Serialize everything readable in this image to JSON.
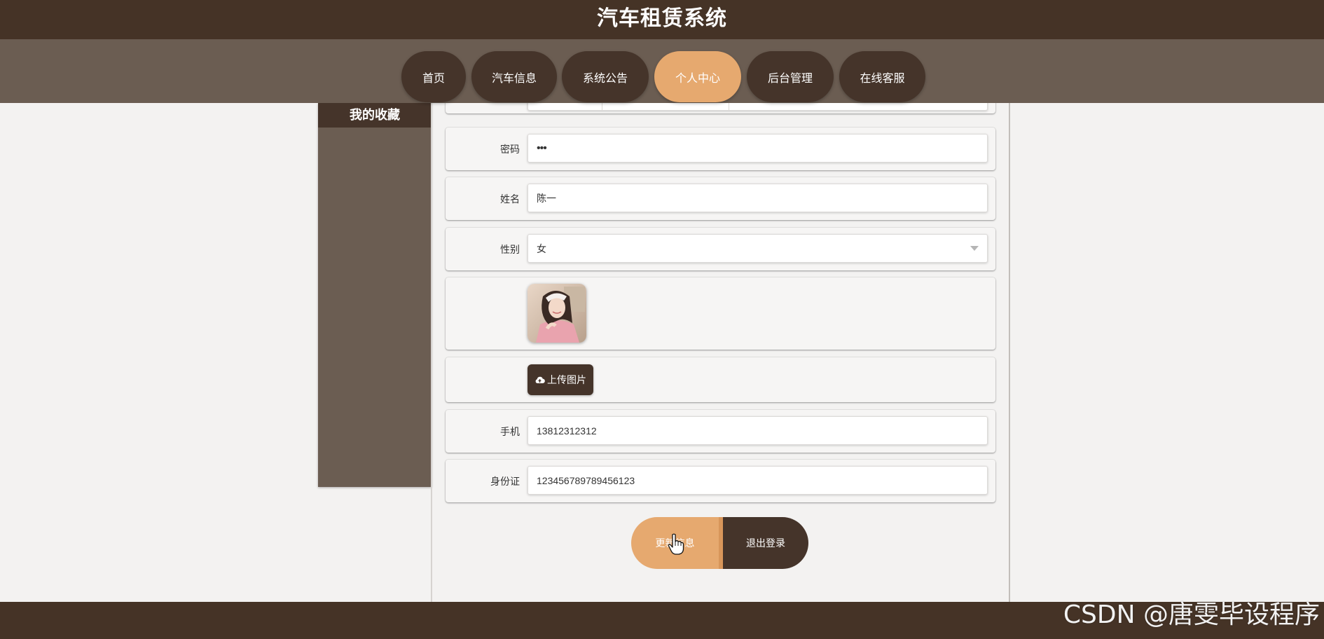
{
  "app": {
    "title": "汽车租赁系统"
  },
  "nav": {
    "items": [
      {
        "label": "首页",
        "active": false
      },
      {
        "label": "汽车信息",
        "active": false
      },
      {
        "label": "系统公告",
        "active": false
      },
      {
        "label": "个人中心",
        "active": true
      },
      {
        "label": "后台管理",
        "active": false
      },
      {
        "label": "在线客服",
        "active": false
      }
    ]
  },
  "sidebar": {
    "items": [
      {
        "label": "我的收藏"
      }
    ]
  },
  "form": {
    "password": {
      "label": "密码",
      "value": "•••"
    },
    "name": {
      "label": "姓名",
      "value": "陈一"
    },
    "gender": {
      "label": "性别",
      "value": "女"
    },
    "upload_label": "上传图片",
    "phone": {
      "label": "手机",
      "value": "13812312312"
    },
    "id_card": {
      "label": "身份证",
      "value": "123456789789456123"
    }
  },
  "actions": {
    "update_label": "更新信息",
    "logout_label": "退出登录"
  },
  "watermark": "CSDN @唐雯毕设程序",
  "colors": {
    "header_bg": "#453326",
    "nav_bg": "#6b5d52",
    "accent": "#e6a96f",
    "dark_button": "#45342a"
  },
  "icons": {
    "upload": "cloud-upload-icon",
    "select": "chevron-down-icon",
    "cursor": "hand-pointer-icon"
  }
}
